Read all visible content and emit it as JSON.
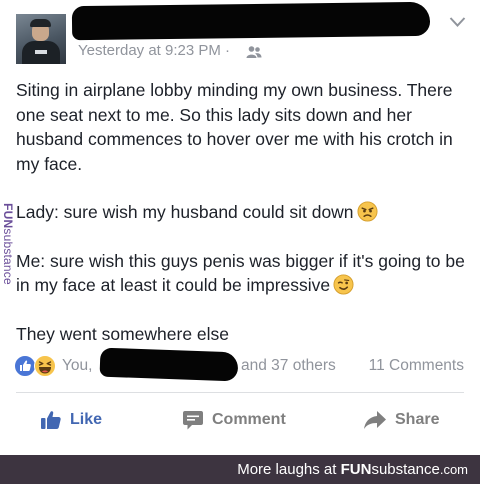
{
  "post": {
    "timestamp": "Yesterday at 9:23 PM ·",
    "audience_icon": "friends-icon",
    "paragraphs": [
      "Siting in airplane lobby minding my own business. There one seat next to me. So this lady sits down and her husband commences to hover over me with his crotch in my face.",
      "Lady: sure wish my husband could sit down",
      "Me: sure wish this guys penis was bigger if it's going to be in my face at least it could be impressive",
      "They went somewhere else"
    ],
    "emoji_1": "angry-face-emoji",
    "emoji_2": "winking-face-emoji"
  },
  "reactions": {
    "icons": [
      "like-icon",
      "haha-icon"
    ],
    "you_label": "You,",
    "others_label": "and 37 others",
    "comments_label": "11 Comments"
  },
  "actions": {
    "like": "Like",
    "comment": "Comment",
    "share": "Share"
  },
  "watermark": {
    "fun": "FUN",
    "substance": "substance"
  },
  "footer": {
    "prefix": "More laughs at ",
    "brand": "FUN",
    "brand2": "substance",
    "tld": ".com"
  },
  "colors": {
    "link_blue": "#4267b2",
    "meta_gray": "#90949c",
    "footer_bg": "#3d3440",
    "watermark_purple": "#6b4f9a"
  }
}
